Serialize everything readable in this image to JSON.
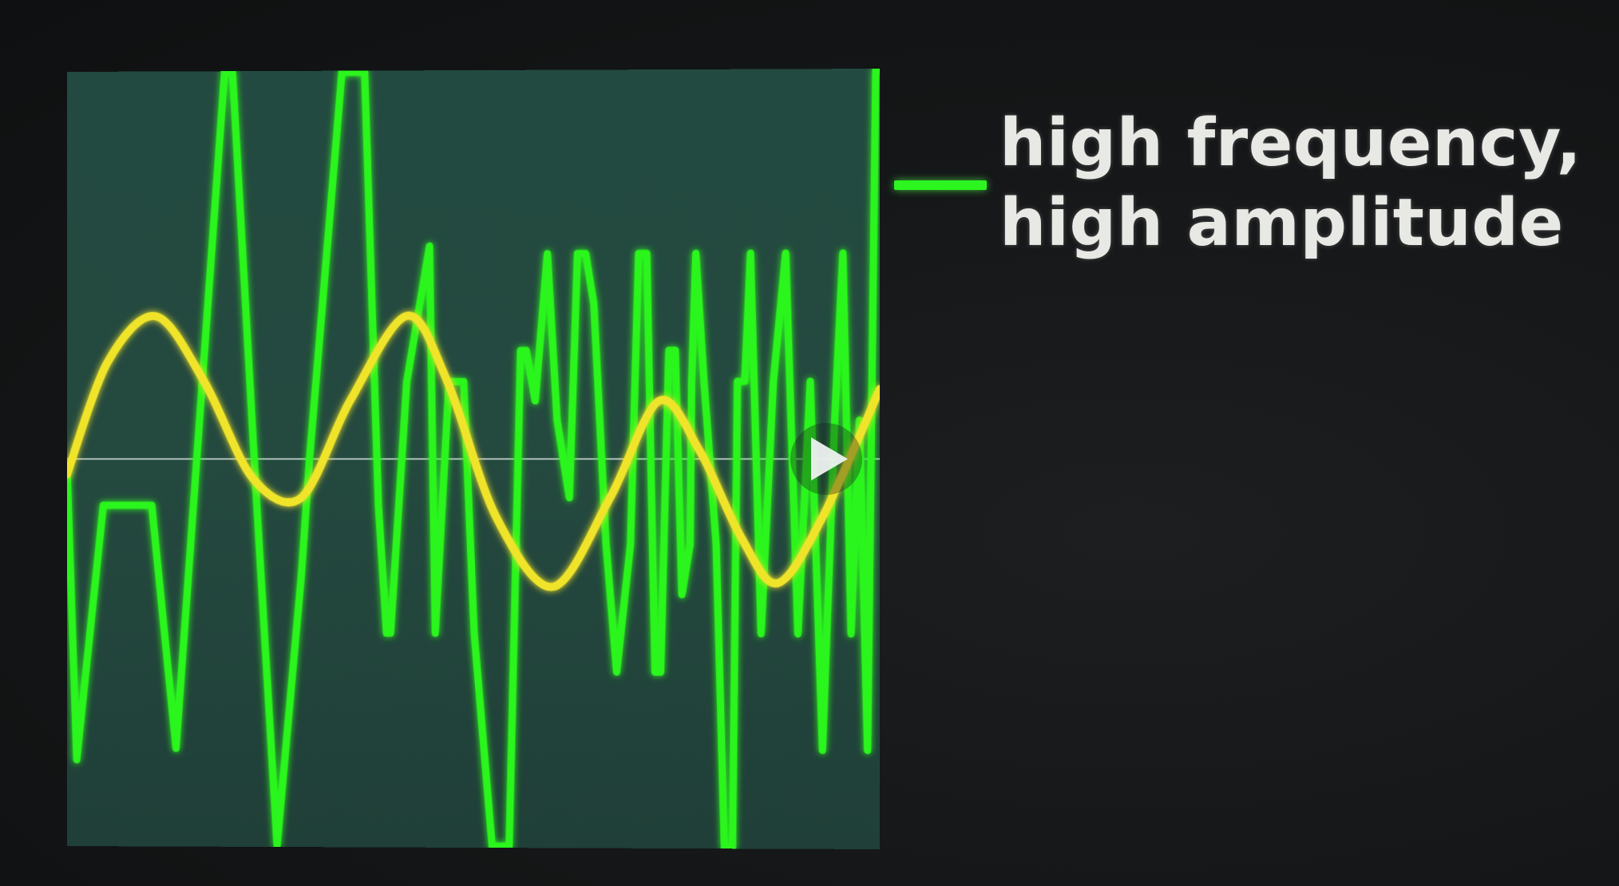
{
  "chart_data": {
    "type": "line",
    "title": "",
    "xlabel": "",
    "ylabel": "",
    "xlim": [
      0,
      1
    ],
    "ylim": [
      -1,
      1
    ],
    "grid": false,
    "legend_position": "right",
    "colors": {
      "plot_background": "#234a41",
      "zero_line": "#c9d6d2",
      "green_series": "#2cf51f",
      "yellow_series": "#f0e42a"
    },
    "series": [
      {
        "name": "high frequency, high amplitude",
        "color": "#2cf51f",
        "x": [
          0.0,
          0.012,
          0.045,
          0.07,
          0.105,
          0.135,
          0.16,
          0.195,
          0.205,
          0.235,
          0.26,
          0.29,
          0.3,
          0.34,
          0.368,
          0.385,
          0.395,
          0.4,
          0.42,
          0.448,
          0.455,
          0.472,
          0.49,
          0.503,
          0.525,
          0.546,
          0.56,
          0.567,
          0.578,
          0.593,
          0.605,
          0.62,
          0.63,
          0.64,
          0.65,
          0.665,
          0.678,
          0.695,
          0.705,
          0.715,
          0.725,
          0.732,
          0.742,
          0.75,
          0.758,
          0.768,
          0.77,
          0.775,
          0.785,
          0.8,
          0.81,
          0.82,
          0.826,
          0.83,
          0.835,
          0.842,
          0.855,
          0.87,
          0.885,
          0.9,
          0.915,
          0.93,
          0.945,
          0.955,
          0.965,
          0.975,
          0.985,
          0.995,
          1.0
        ],
        "y": [
          -0.02,
          -0.78,
          -0.12,
          -0.12,
          -0.12,
          -0.75,
          -0.02,
          1.0,
          1.0,
          -0.12,
          -1.0,
          -0.3,
          0.0,
          1.0,
          1.0,
          -0.12,
          -0.45,
          -0.45,
          0.2,
          0.55,
          -0.45,
          0.2,
          0.2,
          -0.45,
          -1.0,
          -1.0,
          0.28,
          0.28,
          0.15,
          0.53,
          0.1,
          -0.1,
          0.53,
          0.53,
          0.4,
          -0.22,
          -0.55,
          -0.22,
          0.53,
          0.53,
          -0.55,
          -0.55,
          0.28,
          0.28,
          -0.35,
          -0.22,
          0.2,
          0.53,
          0.2,
          -0.22,
          -1.0,
          -1.0,
          0.2,
          0.2,
          0.2,
          0.53,
          -0.45,
          0.2,
          0.53,
          -0.45,
          0.2,
          -0.75,
          0.1,
          0.53,
          -0.45,
          0.1,
          -0.75,
          1.0,
          1.0
        ]
      },
      {
        "name": "",
        "color": "#f0e42a",
        "x": [
          0.0,
          0.05,
          0.11,
          0.17,
          0.23,
          0.29,
          0.35,
          0.42,
          0.47,
          0.53,
          0.6,
          0.67,
          0.73,
          0.78,
          0.83,
          0.875,
          0.93,
          1.0
        ],
        "y": [
          -0.04,
          0.25,
          0.37,
          0.2,
          -0.05,
          -0.1,
          0.15,
          0.37,
          0.2,
          -0.15,
          -0.33,
          -0.1,
          0.15,
          0.02,
          -0.2,
          -0.32,
          -0.15,
          0.18
        ]
      }
    ]
  },
  "legend": {
    "line1": "high frequency,",
    "line2": "high amplitude"
  },
  "controls": {
    "play_icon": "play-icon"
  }
}
